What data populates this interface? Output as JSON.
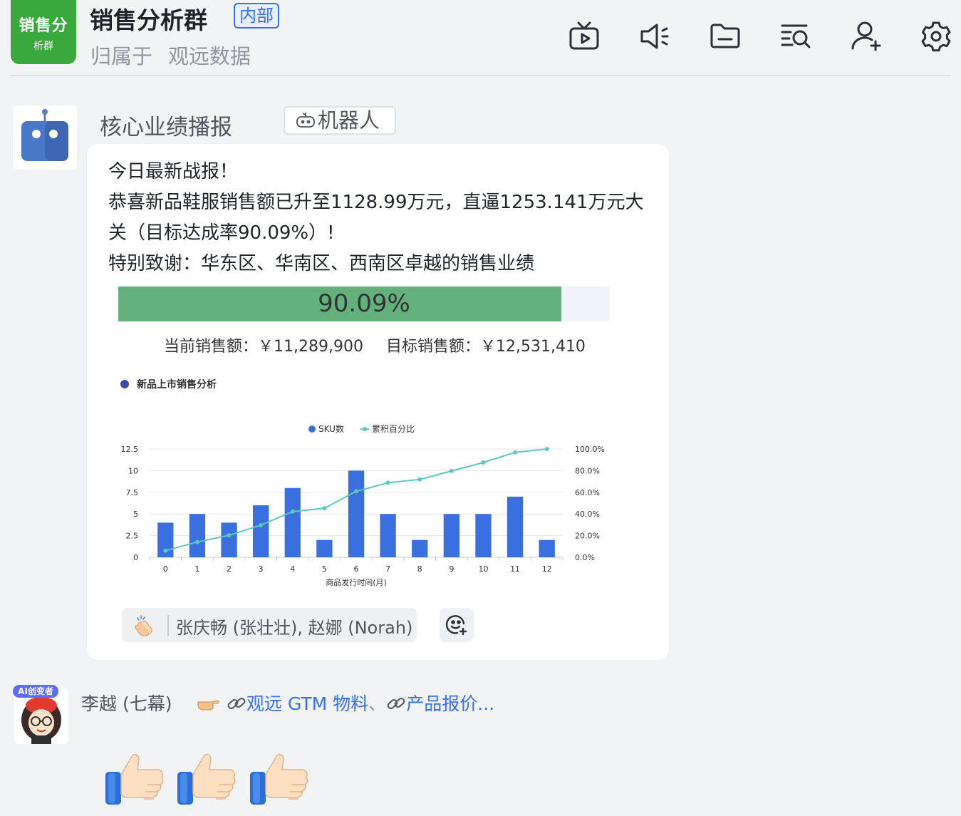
{
  "header": {
    "avatar_line1": "销售分",
    "avatar_line2": "析群",
    "title": "销售分析群",
    "tag": "内部",
    "belongs_label": "归属于",
    "belongs_org": "观远数据",
    "tools": [
      "tv-icon",
      "speaker-icon",
      "folder-icon",
      "search-list-icon",
      "add-user-icon",
      "gear-icon"
    ]
  },
  "bot_message": {
    "sender": "核心业绩播报",
    "robot_tag": "机器人",
    "lines": [
      "今日最新战报！",
      "恭喜新品鞋服销售额已升至1128.99万元，直逼1253.141万元大",
      "关（目标达成率90.09%）!",
      "特别致谢：华东区、华南区、西南区卓越的销售业绩"
    ],
    "progress": {
      "percent": 90.09,
      "label": "90.09%"
    },
    "current_sales": "当前销售额：￥11,289,900",
    "target_sales": "目标销售额：￥12,531,410",
    "reaction": {
      "emoji": "clapping-hands-icon",
      "users": "张庆畅 (张壮壮), 赵娜 (Norah)"
    }
  },
  "chart_data": {
    "type": "bar",
    "title": "新品上市销售分析",
    "xlabel": "商品发行时间(月)",
    "ylabel": "",
    "categories": [
      "0",
      "1",
      "2",
      "3",
      "4",
      "5",
      "6",
      "7",
      "8",
      "9",
      "10",
      "11",
      "12"
    ],
    "y_ticks": [
      "0",
      "2.5",
      "5",
      "7.5",
      "10",
      "12.5"
    ],
    "y2_ticks": [
      "0.0%",
      "20.0%",
      "40.0%",
      "60.0%",
      "80.0%",
      "100.0%"
    ],
    "ylim": [
      0,
      12.5
    ],
    "y2lim": [
      0,
      100
    ],
    "series": [
      {
        "name": "SKU数",
        "type": "bar",
        "color": "#3a6fe0",
        "values": [
          4,
          5,
          4,
          6,
          8,
          2,
          10,
          5,
          2,
          5,
          5,
          7,
          2
        ]
      },
      {
        "name": "累积百分比",
        "type": "line",
        "color": "#5bc9c0",
        "values": [
          6.2,
          14.1,
          20.3,
          29.7,
          42.2,
          45.3,
          60.9,
          68.8,
          71.9,
          79.7,
          87.5,
          96.9,
          100
        ]
      }
    ],
    "legend_position": "top-center",
    "grid": true
  },
  "second_message": {
    "badge": "AI创变者",
    "sender": "李越 (七幕)",
    "link1": "观远 GTM 物料",
    "link2": "产品报价",
    "separator": "、",
    "ellipsis": "...",
    "thumbs": [
      "thumbs-up-icon",
      "thumbs-up-icon",
      "thumbs-up-icon"
    ]
  }
}
